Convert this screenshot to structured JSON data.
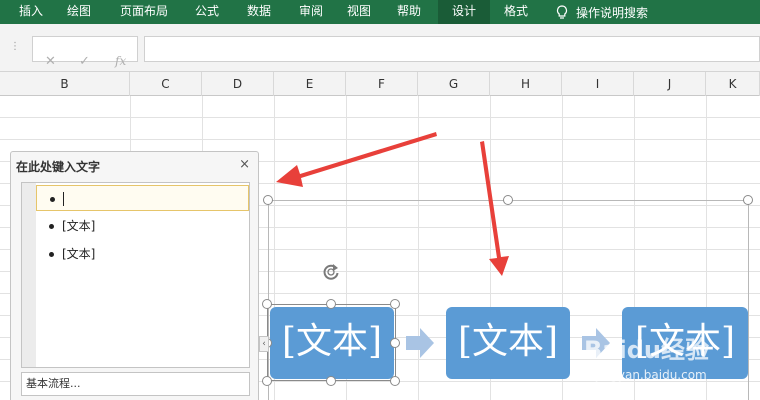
{
  "ribbon": {
    "tabs": [
      "插入",
      "绘图",
      "页面布局",
      "公式",
      "数据",
      "审阅",
      "视图",
      "帮助",
      "设计",
      "格式"
    ],
    "active": "设计",
    "tell_me": "操作说明搜索",
    "color": "#217346"
  },
  "formula_bar": {
    "cancel_icon": "✕",
    "enter_icon": "✓",
    "fx_label": "fx"
  },
  "columns": [
    "B",
    "C",
    "D",
    "E",
    "F",
    "G",
    "H",
    "I",
    "J",
    "K"
  ],
  "text_pane": {
    "title": "在此处键入文字",
    "close": "×",
    "items": [
      "",
      "[文本]",
      "[文本]"
    ],
    "footer": "基本流程...",
    "expand": "‹"
  },
  "smartart": {
    "boxes": [
      "[文本]",
      "[文本]",
      "[文本]"
    ],
    "box_color": "#5b9bd5",
    "arrow_color": "#a9c4e4"
  },
  "annotations": {
    "color": "#e8403a"
  },
  "watermark": {
    "brand": "Baidu经验",
    "url": "jingyan.baidu.com"
  }
}
